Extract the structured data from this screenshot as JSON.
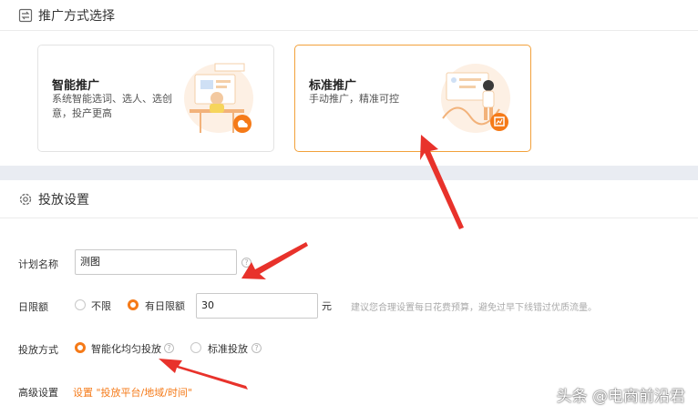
{
  "section1": {
    "title": "推广方式选择",
    "icon": "promotion-switch-icon"
  },
  "cards": {
    "smart": {
      "title": "智能推广",
      "desc": "系统智能选词、选人、选创意，投产更高"
    },
    "standard": {
      "title": "标准推广",
      "desc": "手动推广，精准可控"
    }
  },
  "section2": {
    "title": "投放设置",
    "icon": "gear-icon"
  },
  "form": {
    "plan_name": {
      "label": "计划名称",
      "value": "测图"
    },
    "daily_limit": {
      "label": "日限额",
      "options": [
        "不限",
        "有日限额"
      ],
      "selected": "有日限额",
      "value": "30",
      "unit": "元",
      "hint": "建议您合理设置每日花费预算，避免过早下线错过优质流量。"
    },
    "delivery": {
      "label": "投放方式",
      "options": [
        "智能化均匀投放",
        "标准投放"
      ],
      "selected": "智能化均匀投放"
    },
    "advanced": {
      "label": "高级设置",
      "link": "设置 \"投放平台/地域/时间\""
    }
  },
  "watermark": "头条 @电商前沿君",
  "colors": {
    "accent": "#f57a18",
    "card_selected_border": "#f2a13b",
    "annotation": "#e8322b"
  }
}
